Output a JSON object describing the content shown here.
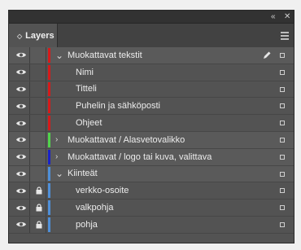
{
  "panel": {
    "title": "Layers",
    "collapse_glyph": "«",
    "close_glyph": "✕",
    "menu_icon": "hamburger-menu-icon"
  },
  "colors": {
    "red": "#d61a1a",
    "green": "#52d34c",
    "blue": "#1a22c8",
    "light_blue": "#4f8fd8"
  },
  "layers": [
    {
      "label": "Muokattavat tekstit",
      "level": 0,
      "expanded": true,
      "color": "red",
      "lock": false,
      "selected_pen": true
    },
    {
      "label": "Nimi",
      "level": 1,
      "color": "red",
      "lock": false
    },
    {
      "label": "Titteli",
      "level": 1,
      "color": "red",
      "lock": false
    },
    {
      "label": "Puhelin ja sähköposti",
      "level": 1,
      "color": "red",
      "lock": false
    },
    {
      "label": "Ohjeet",
      "level": 1,
      "color": "red",
      "lock": false
    },
    {
      "label": "Muokattavat / Alasvetovalikko",
      "level": 0,
      "expanded": false,
      "color": "green",
      "lock": false
    },
    {
      "label": "Muokattavat / logo tai kuva, valittava",
      "level": 0,
      "expanded": false,
      "color": "blue",
      "lock": false
    },
    {
      "label": "Kiinteät",
      "level": 0,
      "expanded": true,
      "color": "light_blue",
      "lock": false
    },
    {
      "label": "verkko-osoite",
      "level": 1,
      "color": "light_blue",
      "lock": true
    },
    {
      "label": "valkpohja",
      "level": 1,
      "color": "light_blue",
      "lock": true
    },
    {
      "label": "pohja",
      "level": 1,
      "color": "light_blue",
      "lock": true
    }
  ]
}
